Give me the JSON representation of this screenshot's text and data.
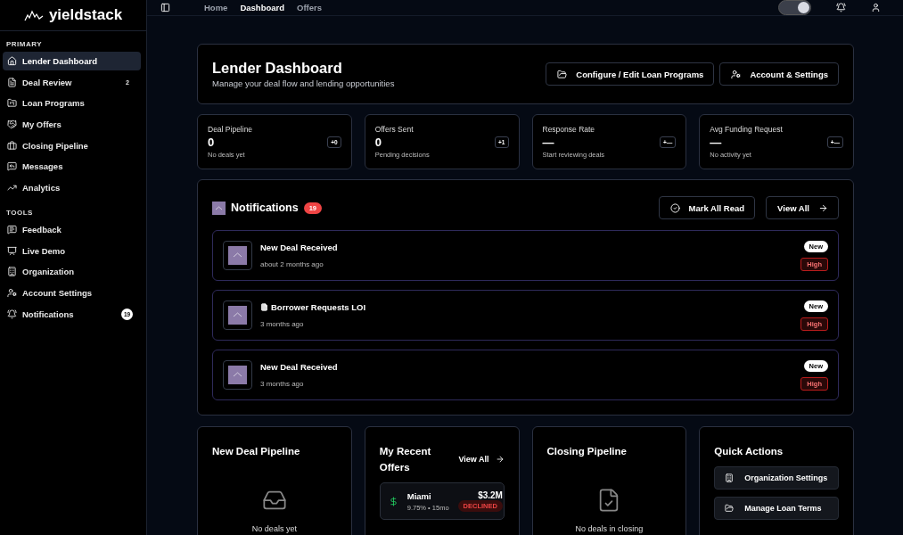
{
  "sidebar": {
    "logo": "yieldstack",
    "sections": [
      {
        "label": "PRIMARY",
        "items": [
          {
            "label": "Lender Dashboard",
            "selected": true
          },
          {
            "label": "Deal Review",
            "selected": false,
            "badge": {
              "text": "2",
              "highlighted": false
            }
          },
          {
            "label": "Loan Programs",
            "selected": false
          },
          {
            "label": "My Offers",
            "selected": false
          },
          {
            "label": "Closing Pipeline",
            "selected": false
          },
          {
            "label": "Messages",
            "selected": false
          },
          {
            "label": "Analytics",
            "selected": false
          }
        ]
      },
      {
        "label": "TOOLS",
        "items": [
          {
            "label": "Feedback",
            "selected": false
          },
          {
            "label": "Live Demo",
            "selected": false
          },
          {
            "label": "Organization",
            "selected": false
          },
          {
            "label": "Account Settings",
            "selected": false
          },
          {
            "label": "Notifications",
            "selected": false,
            "badge": {
              "text": "19",
              "highlighted": true
            }
          }
        ]
      }
    ]
  },
  "topbar": {
    "tabs": [
      {
        "label": "Home",
        "selected": false
      },
      {
        "label": "Dashboard",
        "selected": true
      },
      {
        "label": "Offers",
        "selected": false
      }
    ],
    "theme_toggle": {
      "on": true
    }
  },
  "header": {
    "title": "Lender Dashboard",
    "subtitle": "Manage your deal flow and lending opportunities",
    "buttons": [
      "Configure / Edit Loan Programs",
      "Account & Settings"
    ]
  },
  "stats": [
    {
      "label": "Deal Pipeline",
      "value": "0",
      "change": "+0",
      "note": "No deals yet"
    },
    {
      "label": "Offers Sent",
      "value": "0",
      "change": "+1",
      "note": "Pending decisions"
    },
    {
      "label": "Response Rate",
      "value": "—",
      "change": "+—",
      "note": "Start reviewing deals"
    },
    {
      "label": "Avg Funding Request",
      "value": "—",
      "change": "+—",
      "note": "No activity yet"
    }
  ],
  "notifications": {
    "title": "Notifications",
    "count": "19",
    "mark_all": "Mark All Read",
    "view_all": "View All",
    "items": [
      {
        "title": "New Deal Received",
        "time": "about 2 months ago",
        "doc_icon": false,
        "status": "New",
        "priority": "High"
      },
      {
        "title": "Borrower Requests LOI",
        "time": "3 months ago",
        "doc_icon": true,
        "status": "New",
        "priority": "High"
      },
      {
        "title": "New Deal Received",
        "time": "3 months ago",
        "doc_icon": false,
        "status": "New",
        "priority": "High"
      }
    ]
  },
  "panels": {
    "pipeline": {
      "title": "New Deal Pipeline",
      "empty": "No deals yet"
    },
    "offers": {
      "title": "My Recent Offers",
      "view_all": "View All",
      "items": [
        {
          "city": "Miami",
          "amount": "$3.2M",
          "terms": "9.75% • 15mo",
          "status": "DECLINED"
        }
      ]
    },
    "closing": {
      "title": "Closing Pipeline",
      "empty": "No deals in closing"
    },
    "quick": {
      "title": "Quick Actions",
      "actions": [
        "Organization Settings",
        "Manage Loan Terms"
      ]
    }
  }
}
